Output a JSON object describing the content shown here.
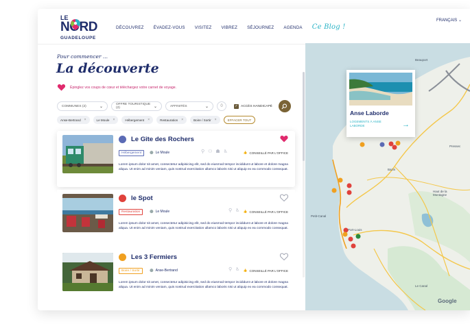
{
  "header": {
    "logo": {
      "le": "LE",
      "nord": "NORD",
      "region": "GUADELOUPE"
    },
    "nav": [
      "DÉCOUVREZ",
      "ÉVADEZ-VOUS",
      "VISITEZ",
      "VIBREZ",
      "SÉJOURNEZ",
      "AGENDA"
    ],
    "blog": "Ce Blog !",
    "language": "FRANÇAIS"
  },
  "intro": {
    "kicker": "Pour commencer ...",
    "title": "La découverte",
    "favorites_note": "Épinglez vos coups de cœur et téléchargez votre carnet de voyage."
  },
  "filters": {
    "communes": "COMMUNES (2)",
    "offre": "OFFRE TOURISTIQUE (2)",
    "affinites": "AFFINITÉS",
    "round": "0",
    "handicap": "ACCÈS HANDICAPÉ"
  },
  "tags": {
    "items": [
      "Anse-Bertrand",
      "Le Moule",
      "Hébergement",
      "Restauration",
      "Boire / Sortir"
    ],
    "clear": "EFFACER TOUT"
  },
  "listings": [
    {
      "name": "Le Gîte des Rochers",
      "category": "Hébergement",
      "town": "Le Moule",
      "recommended": "CONSEILLÉ PAR L'OFFICE",
      "description": "Lorem ipsum dolor sit amet, consectetur adipisicing elit, sed do eiusmod tempor incididunt ut labore et dolore magna aliqua. Ut enim ad minim veniam, quis nostrud exercitation ullamco laboris nisi ut aliquip ex ea commodo consequat.",
      "favorited": true,
      "color": "#5b6bb5"
    },
    {
      "name": "le Spot",
      "category": "Restauration",
      "town": "Le Moule",
      "recommended": "CONSEILLÉ PAR L'OFFICE",
      "description": "Lorem ipsum dolor sit amet, consectetur adipisicing elit, sed do eiusmod tempor incididunt ut labore et dolore magna aliqua. Ut enim ad minim veniam, quis nostrud exercitation ullamco laboris nisi ut aliquip ex ea commodo consequat.",
      "favorited": false,
      "color": "#e0423c"
    },
    {
      "name": "Les 3 Fermiers",
      "category": "Boire / Sortir",
      "town": "Anse-Bertrand",
      "recommended": "CONSEILLÉ PAR L'OFFICE",
      "description": "Lorem ipsum dolor sit amet, consectetur adipisicing elit, sed do eiusmod tempor incididunt ut labore et dolore magna aliqua. Ut enim ad minim veniam, quis nostrud exercitation ullamco laboris nisi ut aliquip ex ea commodo consequat.",
      "favorited": false,
      "color": "#f0a020"
    }
  ],
  "map": {
    "popup_title": "Anse Laborde",
    "popup_link": "LOGEMENTS À ANSE LABORDE",
    "labels": [
      "Port-Louis",
      "Petit-Canal",
      "Pressec",
      "Haut de la Montagne",
      "Beauport",
      "Bazin",
      "Le Canal"
    ],
    "google": "Google"
  }
}
